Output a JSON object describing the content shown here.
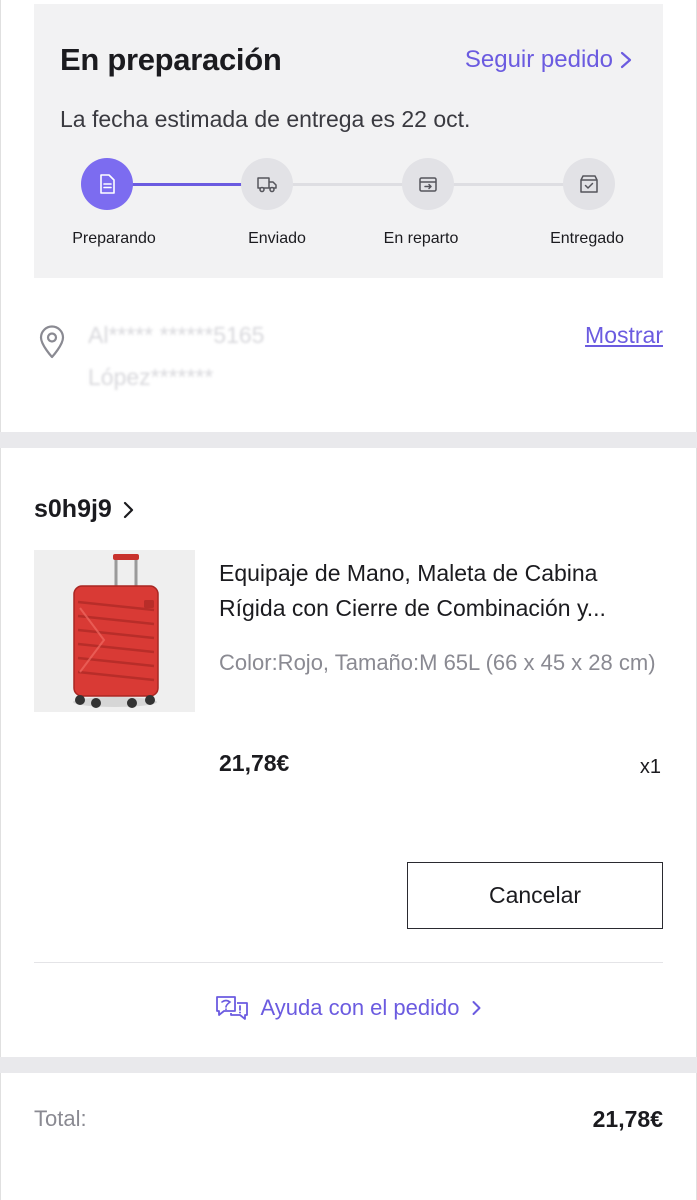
{
  "status": {
    "title": "En preparación",
    "track_link": "Seguir pedido",
    "delivery_estimate": "La fecha estimada de entrega es 22 oct.",
    "steps": [
      {
        "label": "Preparando",
        "icon": "document-icon",
        "active": true
      },
      {
        "label": "Enviado",
        "icon": "truck-icon",
        "active": false
      },
      {
        "label": "En reparto",
        "icon": "delivery-box-icon",
        "active": false
      },
      {
        "label": "Entregado",
        "icon": "package-check-icon",
        "active": false
      }
    ],
    "progress_fraction": 0.35
  },
  "address": {
    "line1": "Al*****  ******5165",
    "line2": "López*******",
    "show_link": "Mostrar",
    "icon": "location-pin-icon"
  },
  "order": {
    "store_name": "s0h9j9",
    "product": {
      "title": "Equipaje de Mano, Maleta de Cabina Rígida con Cierre de Combinación y...",
      "variant": "Color:Rojo, Tamaño:M 65L (66 x 45 x 28 cm)",
      "price": "21,78€",
      "quantity": "x1",
      "image": "red-suitcase"
    },
    "cancel_label": "Cancelar",
    "help_label": "Ayuda con el pedido"
  },
  "summary": {
    "total_label": "Total:",
    "total_value": "21,78€"
  },
  "colors": {
    "accent": "#6b5be0",
    "step_active": "#7c6cf0",
    "card_bg": "#f2f2f3",
    "product_red": "#d93a35"
  }
}
